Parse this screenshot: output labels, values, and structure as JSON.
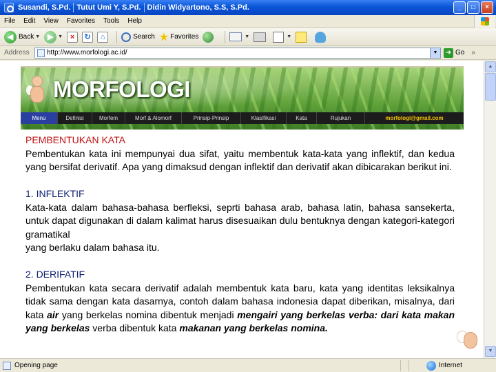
{
  "window": {
    "title_parts": [
      "Susandi, S.Pd.",
      "Tutut Umi Y, S.Pd.",
      "Didin Widyartono, S.S, S.Pd."
    ],
    "controls": [
      "_",
      "□",
      "×"
    ]
  },
  "menu": [
    "File",
    "Edit",
    "View",
    "Favorites",
    "Tools",
    "Help"
  ],
  "toolbar": {
    "back_label": "Back",
    "search_label": "Search",
    "favorites_label": "Favorites"
  },
  "address": {
    "label": "Address",
    "url": "http://www.morfologi.ac.id/",
    "go_label": "Go",
    "links_label": "»"
  },
  "site": {
    "title": "MORFOLOGI",
    "nav": [
      "Menu",
      "Definisi",
      "Morfem",
      "Morf & Alomorf",
      "Prinsip-Prinsip",
      "Klasifikasi",
      "Kata",
      "Rujukan"
    ],
    "email": "morfologi@gmail.com"
  },
  "article": {
    "heading": "PEMBENTUKAN KATA",
    "intro": "Pembentukan kata ini mempunyai dua sifat, yaitu membentuk kata-kata yang inflektif, dan kedua yang bersifat derivatif. Apa yang dimaksud dengan inflektif dan derivatif akan dibicarakan berikut ini.",
    "s1_heading": "1. INFLEKTIF",
    "s1_line1": "Kata-kata dalam bahasa-bahasa berfleksi, seprti bahasa arab, bahasa latin, bahasa sansekerta, untuk dapat digunakan di dalam kalimat harus disesuaikan dulu bentuknya dengan kategori-kategori gramatikal",
    "s1_line2": "yang berlaku dalam bahasa itu.",
    "s2_heading": "2. DERIFATIF",
    "s2_p1": "Pembentukan kata secara derivatif adalah membentuk kata baru, kata yang identitas leksikalnya tidak sama dengan kata dasarnya, contoh dalam bahasa indonesia dapat diberikan, misalnya, dari kata ",
    "s2_air": "air",
    "s2_p2": " yang berkelas nomina dibentuk menjadi ",
    "s2_mengairi": "mengairi yang berkelas verba: dari kata makan yang berkelas",
    "s2_p3": " verba dibentuk kata ",
    "s2_makanan": "makanan yang berkelas nomina."
  },
  "status": {
    "text": "Opening page",
    "zone": "Internet"
  }
}
